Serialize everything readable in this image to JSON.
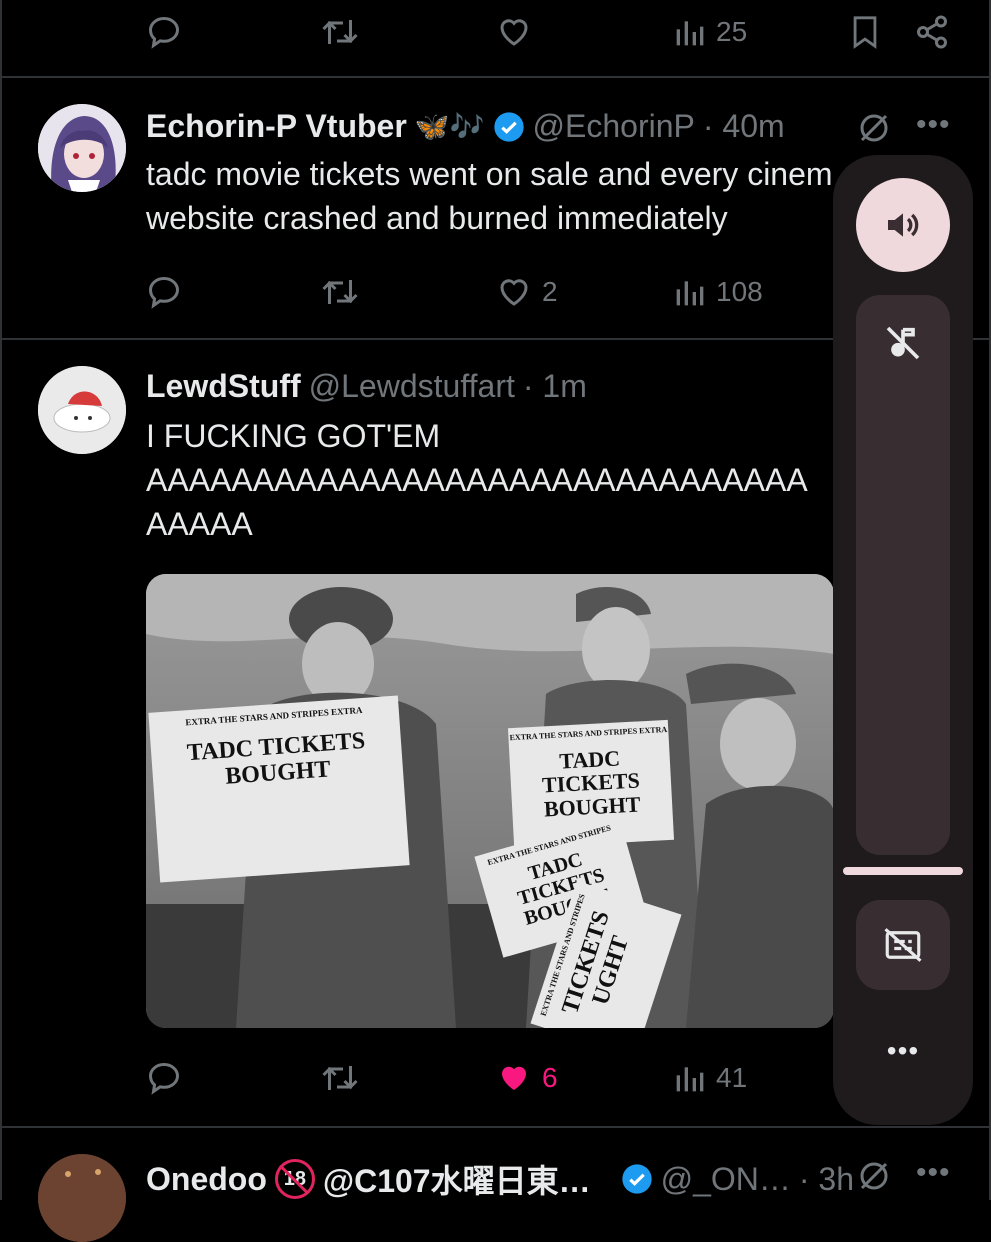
{
  "tweets": [
    {
      "stats": {
        "replies": "",
        "retweets": "",
        "likes": "",
        "views": "25"
      }
    },
    {
      "name": "Echorin-P Vtuber",
      "emoji": "🦋🎶",
      "handle": "@EchorinP",
      "time": "· 40m",
      "lines": [
        "tadc movie tickets went on sale and every cinem",
        "website crashed and burned immediately"
      ],
      "stats": {
        "replies": "",
        "retweets": "",
        "likes": "2",
        "views": "108"
      }
    },
    {
      "name": "LewdStuff",
      "handle": "@Lewdstuffart",
      "time": "· 1m",
      "lines": [
        "I FUCKING GOT'EM",
        "AAAAAAAAAAAAAAAAAAAAAAAAAAAAAAA",
        "AAAAA"
      ],
      "image": {
        "papers": [
          {
            "masthead": "EXTRA  THE STARS AND STRIPES  EXTRA",
            "headline": "TADC TICKETS BOUGHT"
          },
          {
            "masthead": "EXTRA  THE STARS AND STRIPES  EXTRA",
            "headline": "TADC TICKETS BOUGHT"
          },
          {
            "masthead": "EXTRA  THE STARS AND STRIPES",
            "headline": "TADC TICKETS BOUGHT"
          },
          {
            "masthead": "EXTRA  THE STARS AND STRIPES",
            "headline": "TICKETS UGHT"
          }
        ]
      },
      "stats": {
        "replies": "",
        "retweets": "",
        "likes": "6",
        "views": "41"
      }
    },
    {
      "name": "Onedoo",
      "name_badge": "18",
      "name_rest": "@C107水曜日東…",
      "handle": "@_ON…",
      "time": "· 3h"
    }
  ],
  "volume_panel": {
    "more_label": "•••"
  },
  "colors": {
    "background": "#000000",
    "text": "#e7e9ea",
    "muted": "#71767b",
    "like_active": "#f91880",
    "verified": "#1d9bf0",
    "panel": "#1f1a1c",
    "panel_accent": "#f0d9dc"
  }
}
